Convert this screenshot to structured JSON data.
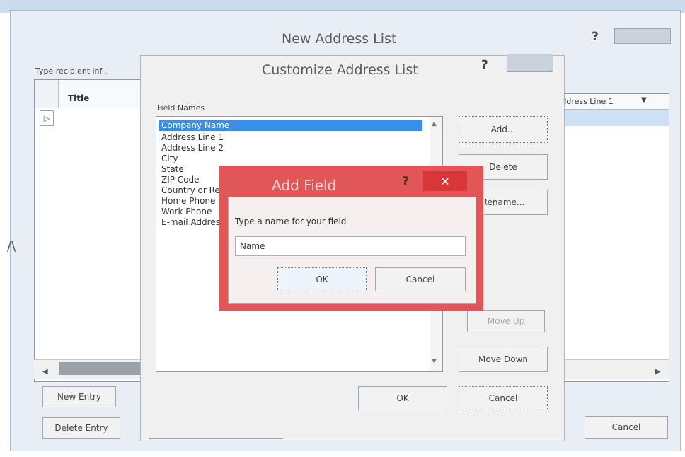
{
  "outer_dialog": {
    "title": "New Address List",
    "help": "?",
    "type_info_label": "Type recipient inf...",
    "col_title": "Title",
    "col_address_line_1": "Address Line 1",
    "new_entry_label": "New Entry",
    "delete_entry_label": "Delete Entry",
    "cancel_label": "Cancel"
  },
  "customize_dialog": {
    "title": "Customize Address List",
    "help": "?",
    "field_names_label": "Field Names",
    "fields": [
      "Company Name",
      "Address Line 1",
      "Address Line 2",
      "City",
      "State",
      "ZIP Code",
      "Country or Re...",
      "Home Phone",
      "Work Phone",
      "E-mail Address"
    ],
    "add_label": "Add...",
    "delete_label": "Delete",
    "rename_label": "Rename...",
    "move_up_label": "Move Up",
    "move_down_label": "Move Down",
    "ok_label": "OK",
    "cancel_label": "Cancel"
  },
  "add_field_dialog": {
    "title": "Add Field",
    "help": "?",
    "close": "✕",
    "prompt": "Type a name for your field",
    "name_value": "Name",
    "ok_label": "OK",
    "cancel_label": "Cancel"
  },
  "colors": {
    "selection": "#3a8ee6",
    "add_dialog_accent": "#e15757",
    "close_button": "#d93737"
  }
}
